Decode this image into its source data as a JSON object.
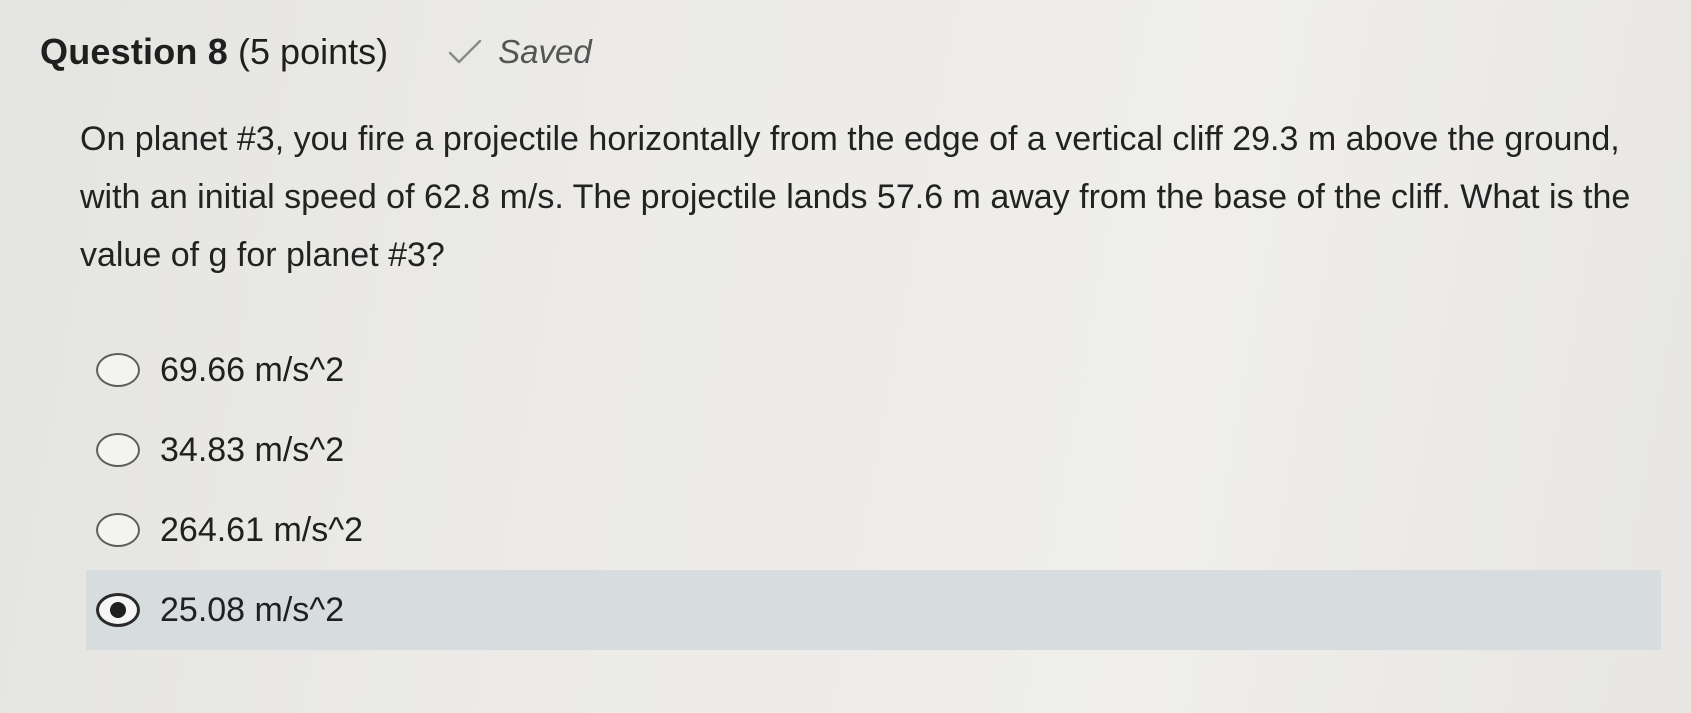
{
  "question": {
    "title": "Question 8",
    "points": "(5 points)",
    "status": "Saved",
    "status_icon": "checkmark-icon",
    "text": "On planet #3, you fire a projectile horizontally from the edge of a vertical cliff 29.3 m above the ground, with an initial speed of 62.8 m/s. The projectile lands 57.6 m away from the base of the cliff. What is the value of g for planet #3?"
  },
  "options": [
    {
      "label": "69.66 m/s^2",
      "selected": false
    },
    {
      "label": "34.83 m/s^2",
      "selected": false
    },
    {
      "label": "264.61 m/s^2",
      "selected": false
    },
    {
      "label": "25.08 m/s^2",
      "selected": true
    }
  ],
  "colors": {
    "selected_row": "#d7dcdf",
    "text": "#1f1f1f",
    "saved_text": "#555555"
  }
}
